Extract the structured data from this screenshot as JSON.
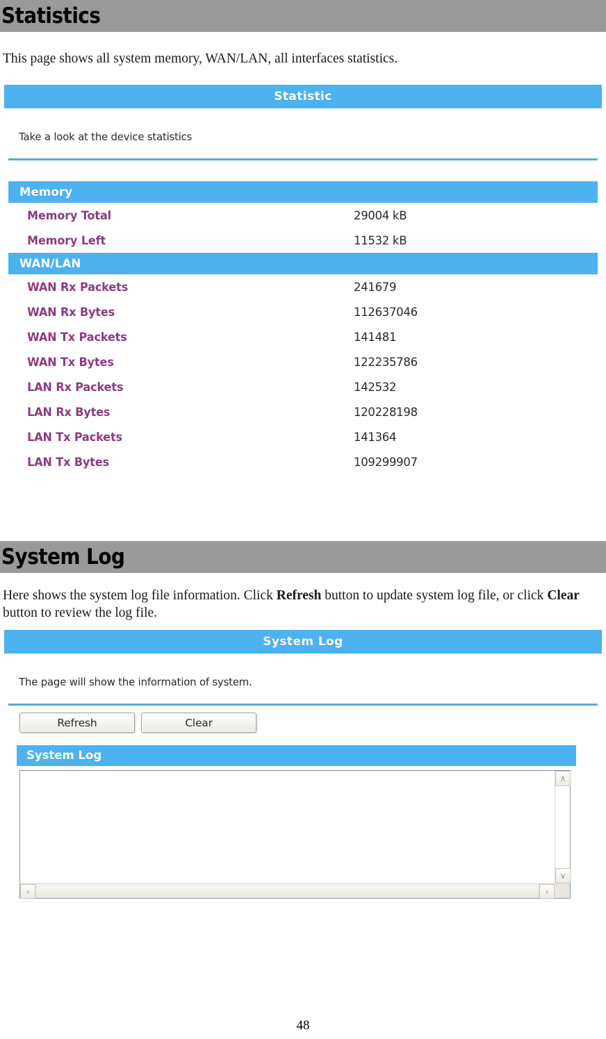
{
  "page": {
    "number": "48",
    "colors": {
      "banner_gray": "#9a9a9a",
      "panel_blue": "#4db2f0",
      "label_purple": "#8d3b80",
      "rule_blue": "#5aa9d6"
    }
  },
  "statistics_section": {
    "heading": "Statistics",
    "intro": "This page shows all system memory, WAN/LAN, all interfaces statistics.",
    "panel": {
      "title": "Statistic",
      "description": "Take a look at the device statistics",
      "groups": [
        {
          "header": "Memory",
          "rows": [
            {
              "label": "Memory Total",
              "value": "29004 kB"
            },
            {
              "label": "Memory Left",
              "value": "11532 kB"
            }
          ]
        },
        {
          "header": "WAN/LAN",
          "rows": [
            {
              "label": "WAN Rx Packets",
              "value": "241679"
            },
            {
              "label": "WAN Rx Bytes",
              "value": "112637046"
            },
            {
              "label": "WAN Tx Packets",
              "value": "141481"
            },
            {
              "label": "WAN Tx Bytes",
              "value": "122235786"
            },
            {
              "label": "LAN Rx Packets",
              "value": "142532"
            },
            {
              "label": "LAN Rx Bytes",
              "value": "120228198"
            },
            {
              "label": "LAN Tx Packets",
              "value": "141364"
            },
            {
              "label": "LAN Tx Bytes",
              "value": "109299907"
            }
          ]
        }
      ]
    }
  },
  "system_log_section": {
    "heading": "System Log",
    "intro_part1": "Here shows the system log file information. Click ",
    "intro_bold1": "Refresh",
    "intro_part2": " button to update system log file, or click ",
    "intro_bold2": "Clear",
    "intro_part3": " button to review the log file.",
    "panel": {
      "title": "System Log",
      "description": "The page will show the information of system.",
      "buttons": {
        "refresh": "Refresh",
        "clear": "Clear"
      },
      "log_header": "System Log",
      "log_value": "",
      "scrollbar": {
        "up": "∧",
        "down": "∨",
        "left": "‹",
        "right": "›"
      }
    }
  }
}
